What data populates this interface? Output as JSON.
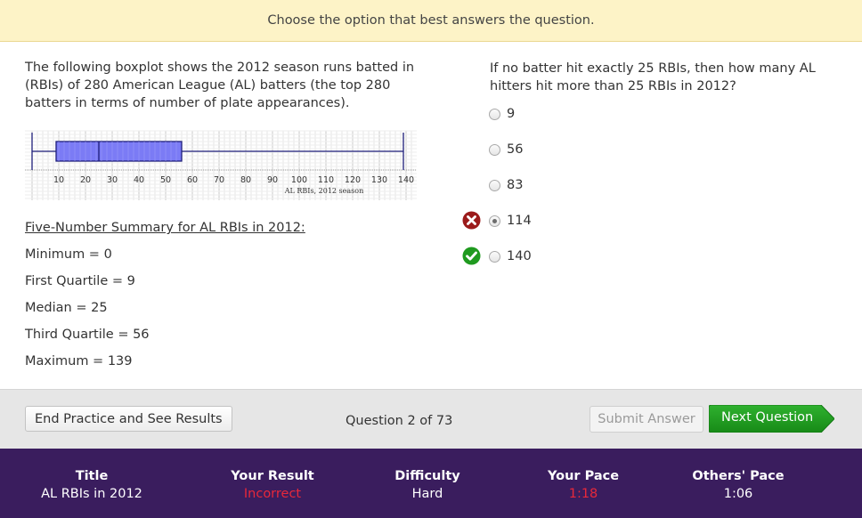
{
  "instruction": "Choose the option that best answers the question.",
  "prompt": "The following boxplot shows the 2012 season runs batted in (RBIs) of 280 American League (AL) batters (the top 280 batters in terms of number of plate appearances).",
  "chart_data": {
    "type": "boxplot",
    "xlabel": "AL RBIs, 2012 season",
    "ticks": [
      "10",
      "20",
      "30",
      "40",
      "50",
      "60",
      "70",
      "80",
      "90",
      "100",
      "110",
      "120",
      "130",
      "140"
    ],
    "xlim": [
      0,
      140
    ],
    "min": 0,
    "q1": 9,
    "median": 25,
    "q3": 56,
    "max": 139,
    "box_color": "#7b7bf5",
    "grid": true
  },
  "summary": {
    "title": "Five-Number Summary for AL RBIs in 2012:",
    "lines": [
      "Minimum = 0",
      "First Quartile = 9",
      "Median = 25",
      "Third Quartile = 56",
      "Maximum = 139"
    ]
  },
  "question": "If no batter hit exactly 25 RBIs, then how many AL hitters hit more than 25 RBIs in 2012?",
  "options": [
    {
      "label": "9",
      "selected": false
    },
    {
      "label": "56",
      "selected": false
    },
    {
      "label": "83",
      "selected": false
    },
    {
      "label": "114",
      "selected": true,
      "mark": "incorrect"
    },
    {
      "label": "140",
      "selected": false,
      "mark": "correct"
    }
  ],
  "actions": {
    "end": "End Practice and See Results",
    "counter": "Question 2 of 73",
    "submit": "Submit Answer",
    "next": "Next Question"
  },
  "stats": [
    {
      "label": "Title",
      "value": "AL RBIs in 2012"
    },
    {
      "label": "Your Result",
      "value": "Incorrect",
      "color": "#e8283a"
    },
    {
      "label": "Difficulty",
      "value": "Hard"
    },
    {
      "label": "Your Pace",
      "value": "1:18",
      "color": "#e8283a"
    },
    {
      "label": "Others' Pace",
      "value": "1:06"
    }
  ],
  "colors": {
    "instruction_bg": "#fdf3c7",
    "stats_bg": "#3a1d5e",
    "next_button": "#1f9a1f",
    "correct": "#1f9a1f",
    "incorrect": "#9b1b1b"
  }
}
